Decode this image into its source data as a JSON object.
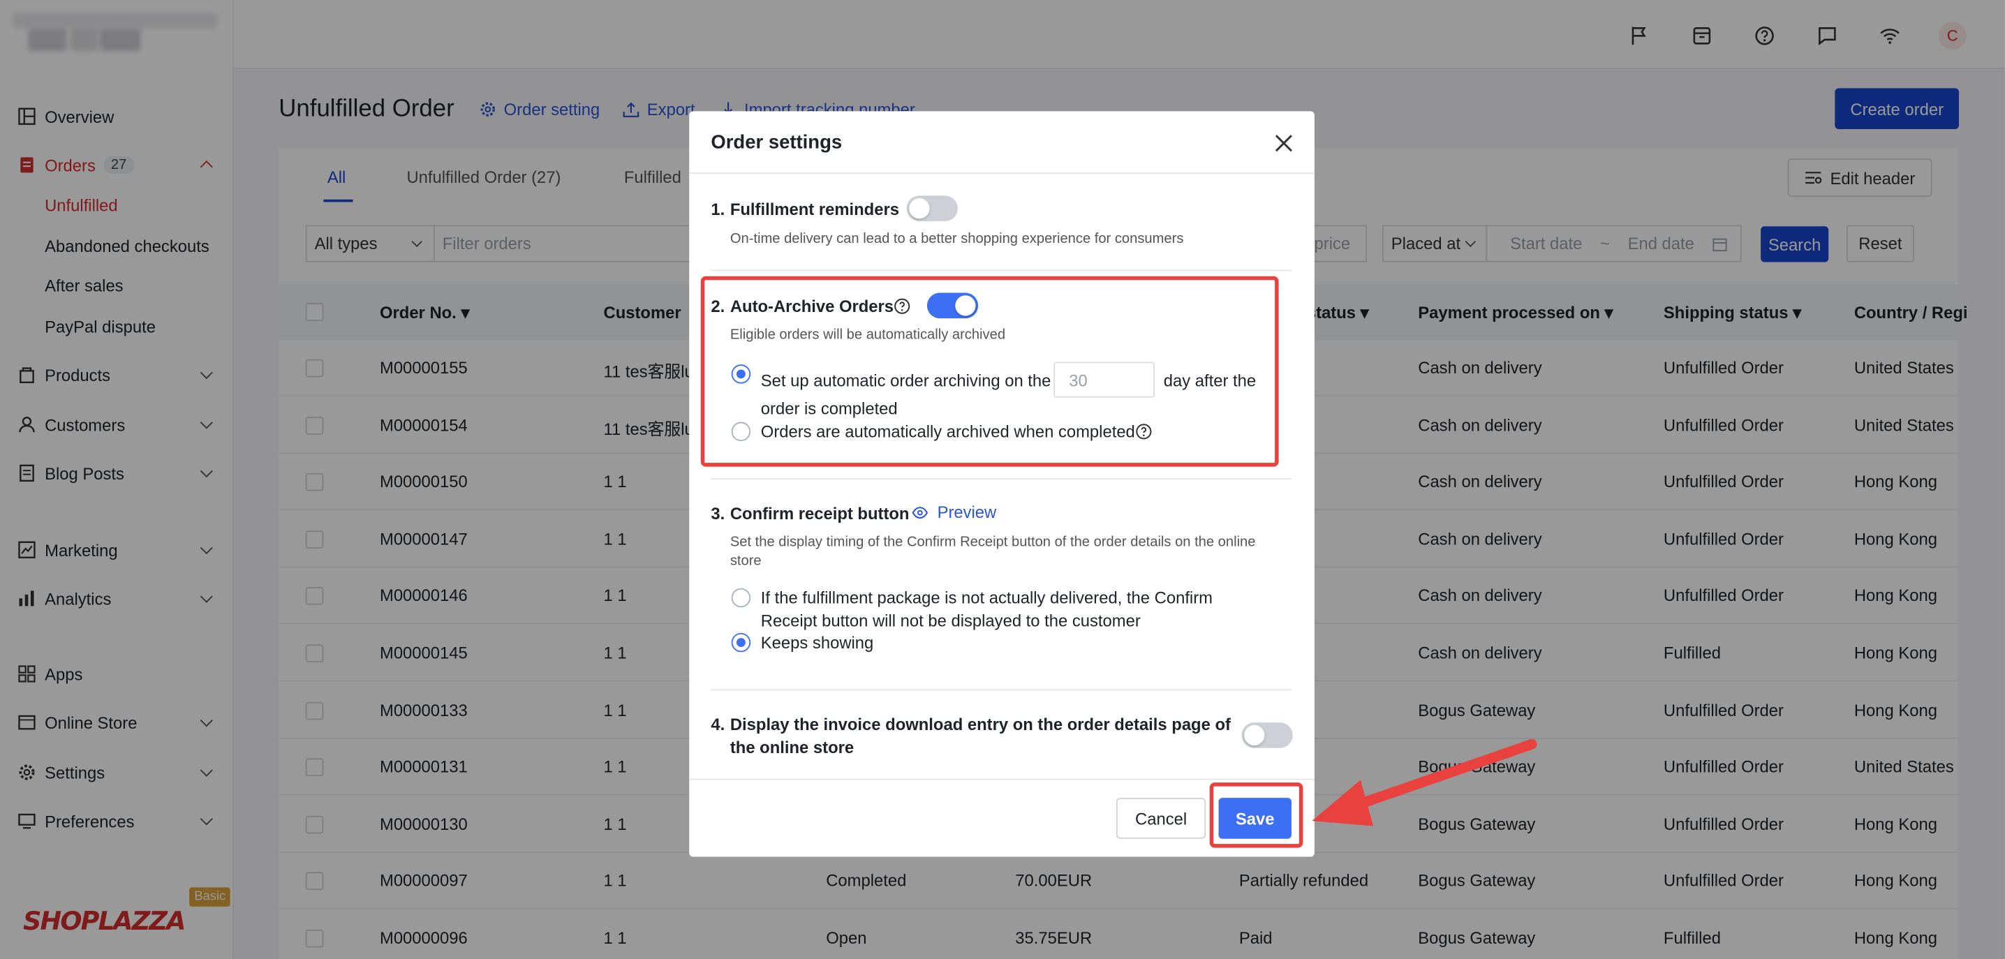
{
  "colors": {
    "accent": "#1a47d1",
    "brand": "#d62d2d",
    "toggle_on": "#3d6ff5",
    "highlight": "#e8413e"
  },
  "sidebar": {
    "items": [
      {
        "label": "Overview",
        "icon": "overview-icon"
      },
      {
        "label": "Orders",
        "icon": "orders-icon",
        "count": "27",
        "expanded": true
      },
      {
        "label": "Products",
        "icon": "products-icon"
      },
      {
        "label": "Customers",
        "icon": "customers-icon"
      },
      {
        "label": "Blog Posts",
        "icon": "blog-icon"
      },
      {
        "label": "Marketing",
        "icon": "marketing-icon"
      },
      {
        "label": "Analytics",
        "icon": "analytics-icon"
      },
      {
        "label": "Apps",
        "icon": "apps-icon"
      },
      {
        "label": "Online Store",
        "icon": "store-icon"
      },
      {
        "label": "Settings",
        "icon": "gear-icon"
      },
      {
        "label": "Preferences",
        "icon": "monitor-icon"
      }
    ],
    "order_subitems": [
      "Unfulfilled",
      "Abandoned checkouts",
      "After sales",
      "PayPal dispute"
    ],
    "brand": "SHOPLAZZA",
    "plan_badge": "Basic"
  },
  "topbar": {
    "avatar_letter": "C",
    "icons": [
      "flag-icon",
      "archive-icon",
      "help-icon",
      "chat-icon",
      "wifi-icon"
    ]
  },
  "header": {
    "title": "Unfulfilled Order",
    "order_setting": "Order setting",
    "export": "Export",
    "import_tracking": "Import tracking number",
    "create_order": "Create order"
  },
  "tabs": [
    {
      "label": "All",
      "active": true
    },
    {
      "label": "Unfulfilled Order  (27)"
    },
    {
      "label": "Fulfilled"
    }
  ],
  "edit_header": "Edit header",
  "filters": {
    "type": "All types",
    "search_placeholder": "Filter orders",
    "price_stub": "price",
    "date_field": "Placed at",
    "start_placeholder": "Start date",
    "date_sep": "~",
    "end_placeholder": "End date",
    "search_btn": "Search",
    "reset_btn": "Reset"
  },
  "table": {
    "columns": [
      "Order No.",
      "Customer",
      "status",
      "Payment processed on",
      "Shipping status",
      "Country / Regi"
    ],
    "rows": [
      {
        "order": "M00000155",
        "customer": "11 tes客服lu",
        "status": "",
        "amount": "",
        "payment_status": "",
        "gateway": "Cash on delivery",
        "shipping": "Unfulfilled Order",
        "country": "United States"
      },
      {
        "order": "M00000154",
        "customer": "11 tes客服lu",
        "status": "",
        "amount": "",
        "payment_status": "",
        "gateway": "Cash on delivery",
        "shipping": "Unfulfilled Order",
        "country": "United States"
      },
      {
        "order": "M00000150",
        "customer": "1 1",
        "status": "",
        "amount": "",
        "payment_status": "",
        "gateway": "Cash on delivery",
        "shipping": "Unfulfilled Order",
        "country": "Hong Kong"
      },
      {
        "order": "M00000147",
        "customer": "1 1",
        "status": "",
        "amount": "",
        "payment_status": "",
        "gateway": "Cash on delivery",
        "shipping": "Unfulfilled Order",
        "country": "Hong Kong"
      },
      {
        "order": "M00000146",
        "customer": "1 1",
        "status": "",
        "amount": "",
        "payment_status": "",
        "gateway": "Cash on delivery",
        "shipping": "Unfulfilled Order",
        "country": "Hong Kong"
      },
      {
        "order": "M00000145",
        "customer": "1 1",
        "status": "",
        "amount": "",
        "payment_status": "",
        "gateway": "Cash on delivery",
        "shipping": "Fulfilled",
        "country": "Hong Kong"
      },
      {
        "order": "M00000133",
        "customer": "1 1",
        "status": "",
        "amount": "",
        "payment_status": "",
        "gateway": "Bogus Gateway",
        "shipping": "Unfulfilled Order",
        "country": "Hong Kong"
      },
      {
        "order": "M00000131",
        "customer": "1 1",
        "status": "",
        "amount": "",
        "payment_status": "",
        "gateway": "Bogus Gateway",
        "shipping": "Unfulfilled Order",
        "country": "United States"
      },
      {
        "order": "M00000130",
        "customer": "1 1",
        "status": "",
        "amount": "",
        "payment_status": "",
        "gateway": "Bogus Gateway",
        "shipping": "Unfulfilled Order",
        "country": "Hong Kong"
      },
      {
        "order": "M00000097",
        "customer": "1 1",
        "status": "Completed",
        "amount": "70.00EUR",
        "payment_status": "Partially refunded",
        "gateway": "Bogus Gateway",
        "shipping": "Unfulfilled Order",
        "country": "Hong Kong"
      },
      {
        "order": "M00000096",
        "customer": "1 1",
        "status": "Open",
        "amount": "35.75EUR",
        "payment_status": "Paid",
        "gateway": "Bogus Gateway",
        "shipping": "Fulfilled",
        "country": "Hong Kong"
      }
    ]
  },
  "modal": {
    "title": "Order settings",
    "s1": {
      "num": "1.",
      "title": "Fulfillment reminders",
      "enabled": false,
      "desc": "On-time delivery can lead to a better shopping experience for consumers"
    },
    "s2": {
      "num": "2.",
      "title": "Auto-Archive Orders",
      "enabled": true,
      "desc": "Eligible orders will be automatically archived",
      "opt1_before": "Set up automatic order archiving on the",
      "days_placeholder": "30",
      "opt1_after": "day after the",
      "opt1_line2": "order is completed",
      "opt2": "Orders are automatically archived when completed",
      "selected": 1
    },
    "s3": {
      "num": "3.",
      "title": "Confirm receipt button",
      "preview": "Preview",
      "desc_line1": "Set the display timing of the Confirm Receipt button of the order details on the online",
      "desc_line2": "store",
      "opt1_line1": "If the fulfillment package is not actually delivered, the Confirm",
      "opt1_line2": "Receipt button will not be displayed to the customer",
      "opt2": "Keeps showing",
      "selected": 2
    },
    "s4": {
      "num": "4.",
      "title_line1": "Display the invoice download entry on the order details page of",
      "title_line2": "the online store",
      "enabled": false
    },
    "cancel": "Cancel",
    "save": "Save"
  }
}
